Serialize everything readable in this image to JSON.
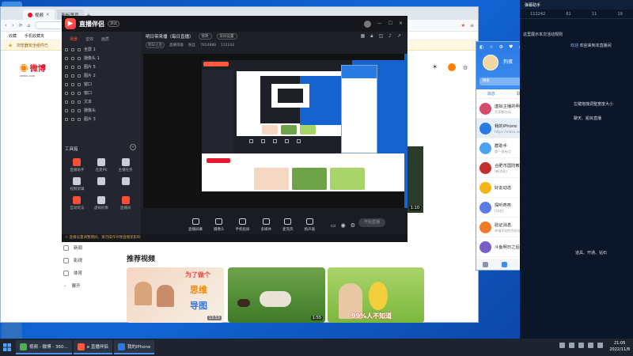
{
  "browser": {
    "tabs": [
      {
        "label": "视频",
        "active": true
      },
      {
        "label": "新标签页",
        "active": false
      }
    ],
    "url": "",
    "bookmarks": [
      "收藏",
      "手机收藏夹"
    ],
    "infobar_text": "浏览器安全组件已",
    "weibo_logo": "微博",
    "weibo_sub": "weibo.com",
    "left_nav": [
      "新闻",
      "影视",
      "体育"
    ],
    "left_nav_more": "展开",
    "recommend_title": "推荐视频",
    "thumb_texts": {
      "t1": "为了做个",
      "t2": "思维",
      "t3": "导图",
      "t4": "99%人不知道"
    },
    "durations": [
      "13:53",
      "1:55",
      "1:10"
    ]
  },
  "zbj": {
    "app_title": "直播伴侣",
    "version": "测试",
    "side_tabs": [
      "场景",
      "音效",
      "画质"
    ],
    "scenes": [
      "全屏 1",
      "摄像头 1",
      "图片 5",
      "图片 2",
      "窗口",
      "窗口",
      "文本",
      "摄像头",
      "图片 3"
    ],
    "tools_head": "工具箱",
    "tools": [
      {
        "label": "直播助手",
        "red": true
      },
      {
        "label": "连麦PK",
        "red": false
      },
      {
        "label": "主播任务",
        "red": false
      },
      {
        "label": "视频剪辑",
        "red": false
      },
      {
        "label": "",
        "red": false
      },
      {
        "label": "",
        "red": false
      },
      {
        "label": "互动玩法",
        "red": true
      },
      {
        "label": "虚拟形象",
        "red": false
      },
      {
        "label": "直播间",
        "red": true
      }
    ],
    "room_title": "明日带来播（每日直播）",
    "room_btn1": "修改",
    "room_btn2": "房间设置",
    "info1": "明日之后",
    "info2": "直播等级",
    "info3": "粉丝",
    "info4": "7854888",
    "info5": "112242",
    "ctrls": [
      "直播屏幕",
      "摄像头",
      "手机投屏",
      "多媒体",
      "麦克风",
      "扬声器"
    ],
    "start_label": "开始直播",
    "notice": "直播设置调整期间，请勿操作导致直播受影响"
  },
  "qq": {
    "nickname": "狗蛋",
    "search_placeholder": "搜索",
    "tabs": [
      "消息",
      "联系人",
      "空间"
    ],
    "conversations": [
      {
        "name": "虚拟主播的明日之后",
        "sub": "大家都在玩",
        "time": "11:4",
        "badge": false,
        "avatar": "#d44b6b",
        "selected": false
      },
      {
        "name": "我的iPhone",
        "sub": "https://video.weibo.com/...",
        "time": "21:0",
        "badge": false,
        "avatar": "#2a7ae4",
        "selected": true
      },
      {
        "name": "群助手",
        "sub": "第一批有点",
        "time": "11:3",
        "badge": false,
        "avatar": "#4aa3f0",
        "selected": false
      },
      {
        "name": "合肥市国防教育协会",
        "sub": "[新消息]",
        "time": "11:0",
        "badge": true,
        "avatar": "#c42d2d",
        "selected": false
      },
      {
        "name": "好友动态",
        "sub": "",
        "time": "",
        "badge": true,
        "avatar": "#f3b519",
        "selected": false
      },
      {
        "name": "探听咚咚",
        "sub": "[动态]",
        "time": "11:5",
        "badge": false,
        "avatar": "#5b7ce8",
        "selected": false
      },
      {
        "name": "验证消息",
        "sub": "申请添加你为好友",
        "time": "11:5",
        "badge": true,
        "avatar": "#f07c2a",
        "selected": false
      },
      {
        "name": "斗鱼明日之后主播群",
        "sub": "",
        "time": "11:0",
        "badge": false,
        "avatar": "#7a5cc8",
        "selected": false
      }
    ]
  },
  "chat": {
    "header": "弹幕助手",
    "stats": [
      "112242",
      "61",
      "11",
      "19"
    ],
    "messages": [
      {
        "name": "",
        "text": "这里展示本次活动规则"
      },
      {
        "name": "欢迎",
        "text": "欢迎来到本直播间"
      },
      {
        "name": "",
        "text": "左键拖拽调整宽度大小"
      },
      {
        "name": "",
        "text": "聊天、船目直播"
      },
      {
        "name": "",
        "text": "道具、开通、钻石"
      }
    ]
  },
  "taskbar": {
    "tasks": [
      {
        "label": "视频 - 微博 - 360...",
        "color": "#4caf50"
      },
      {
        "label": "e 直播伴侣",
        "color": "#ff5a3c"
      },
      {
        "label": "我的iPhone",
        "color": "#2a7ae4"
      }
    ],
    "time": "21:05",
    "date": "2022/11/8"
  }
}
